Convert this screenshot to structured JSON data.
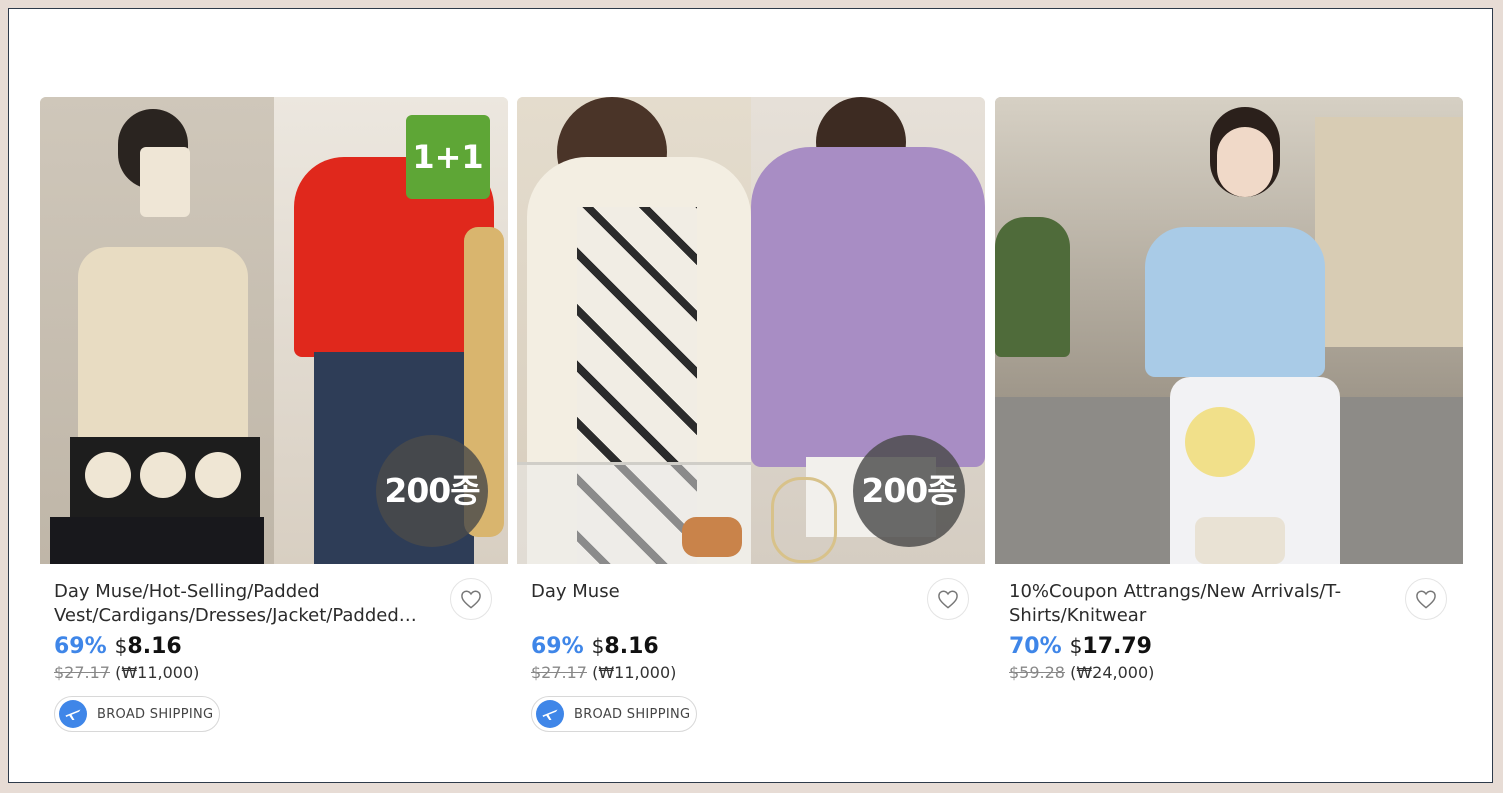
{
  "products": [
    {
      "title": "Day Muse/Hot-Selling/Padded Vest/Cardigans/Dresses/Jacket/Padded Vest/Coats",
      "discount": "69%",
      "currency": "$",
      "price": "8.16",
      "original_price": "$27.17",
      "krw_price": "(₩11,000)",
      "badge_top": "1+1",
      "badge_bottom": "200종",
      "shipping": "BROAD SHIPPING"
    },
    {
      "title": "Day Muse",
      "discount": "69%",
      "currency": "$",
      "price": "8.16",
      "original_price": "$27.17",
      "krw_price": "(₩11,000)",
      "badge_bottom": "200종",
      "shipping": "BROAD SHIPPING"
    },
    {
      "title": "10%Coupon Attrangs/New Arrivals/T-Shirts/Knitwear",
      "discount": "70%",
      "currency": "$",
      "price": "17.79",
      "original_price": "$59.28",
      "krw_price": "(₩24,000)"
    }
  ],
  "colors": {
    "discount": "#3f86e8",
    "badge_green": "#5ea636",
    "shipping_icon": "#3f86e8"
  },
  "icons": {
    "wishlist": "heart-outline-icon",
    "shipping": "airplane-icon"
  }
}
